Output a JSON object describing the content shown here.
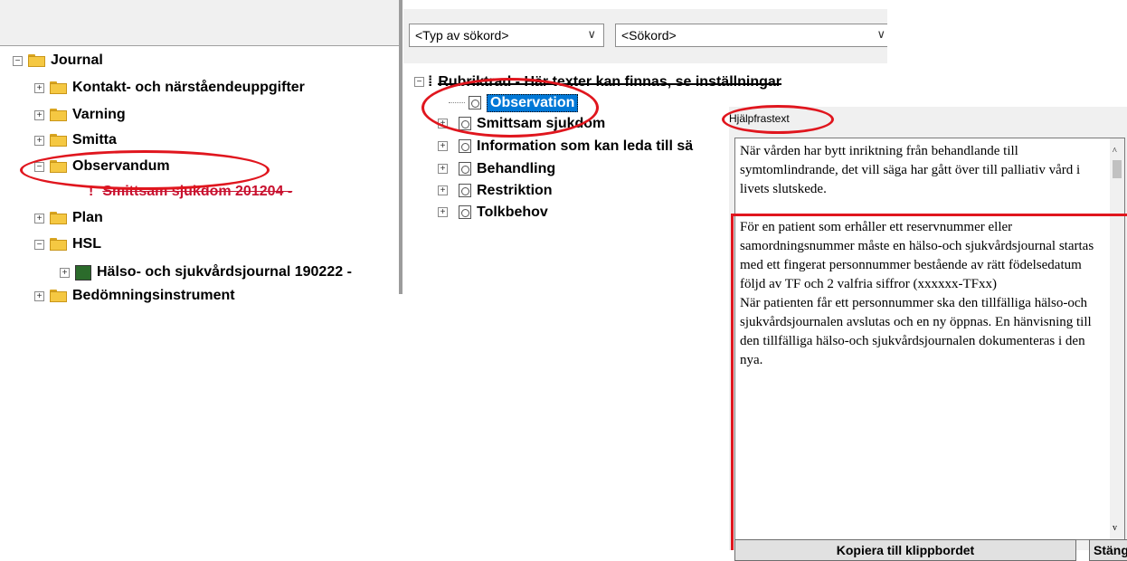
{
  "left_tree": {
    "root": "Journal",
    "items": [
      {
        "label": "Kontakt- och närståendeuppgifter"
      },
      {
        "label": "Varning"
      },
      {
        "label": "Smitta"
      },
      {
        "label": "Observandum"
      },
      {
        "label": "Smittsam sjukdom 201204 -"
      },
      {
        "label": "Plan"
      },
      {
        "label": "HSL"
      },
      {
        "label": "Hälso- och sjukvårdsjournal 190222 -"
      },
      {
        "label": "Bedömningsinstrument"
      }
    ]
  },
  "search": {
    "type_placeholder": "<Typ av sökord>",
    "keyword_placeholder": "<Sökord>"
  },
  "rubrik_tree": {
    "root": "Rubriktrad - Här texter kan finnas, se inställningar",
    "items": [
      {
        "label": "Observation"
      },
      {
        "label": "Smittsam sjukdom"
      },
      {
        "label": "Information som kan leda till sä"
      },
      {
        "label": "Behandling"
      },
      {
        "label": "Restriktion"
      },
      {
        "label": "Tolkbehov"
      }
    ]
  },
  "help": {
    "label": "Hjälpfrastext",
    "paragraphs": [
      "När vården har bytt inriktning från behandlande till symtomlindrande, det vill säga har gått över till palliativ vård i livets slutskede.",
      "För en patient som erhåller ett reservnummer eller samordningsnummer måste en hälso-och sjukvårdsjournal startas med ett fingerat personnummer bestående av rätt födelsedatum följd av TF och 2 valfria siffror (xxxxxx-TFxx)\nNär patienten får ett personnummer ska den tillfälliga hälso-och sjukvårdsjournalen avslutas och en ny öppnas. En hänvisning till den tillfälliga hälso-och sjukvårdsjournalen dokumenteras i den nya."
    ],
    "copy_button": "Kopiera till klippbordet",
    "close_button": "Stäng"
  },
  "colors": {
    "annotation": "#e0161e",
    "selection": "#0078d7",
    "link_red": "#c8102e"
  }
}
